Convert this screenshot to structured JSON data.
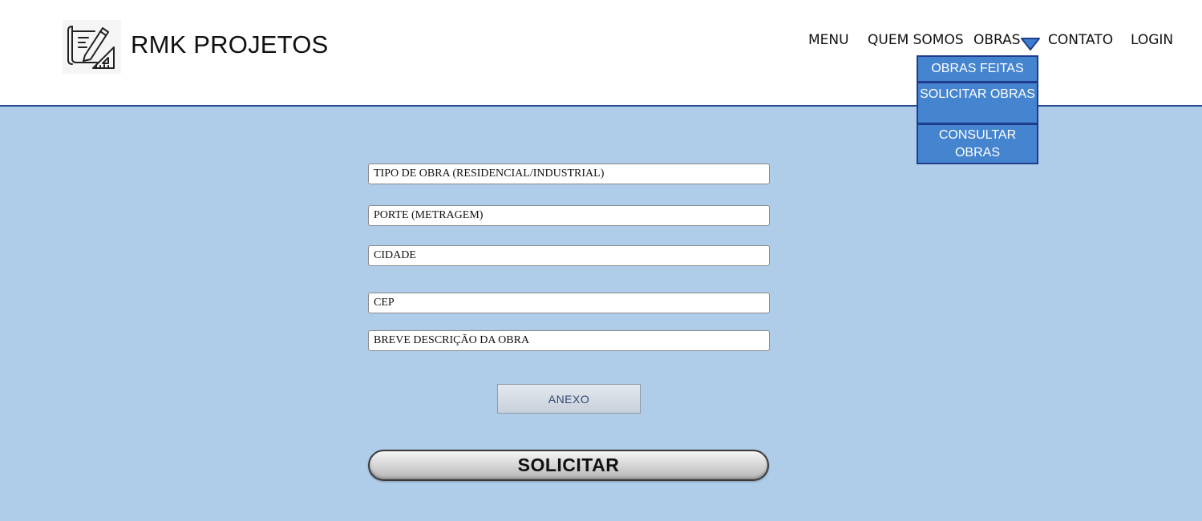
{
  "header": {
    "brand": "RMK PROJETOS",
    "logo_icon": "blueprint-pencil-ruler-icon"
  },
  "nav": {
    "menu": "MENU",
    "about": "QUEM SOMOS",
    "works": "OBRAS",
    "contact": "CONTATO",
    "login": "LOGIN",
    "works_caret_icon": "caret-down-icon"
  },
  "dropdown": {
    "items": [
      "OBRAS FEITAS",
      "SOLICITAR OBRAS",
      "CONSULTAR OBRAS"
    ]
  },
  "form": {
    "fields": [
      {
        "placeholder": "TIPO DE OBRA (RESIDENCIAL/INDUSTRIAL)"
      },
      {
        "placeholder": "PORTE (METRAGEM)"
      },
      {
        "placeholder": "CIDADE"
      },
      {
        "placeholder": "CEP"
      },
      {
        "placeholder": "BREVE DESCRIÇÃO DA OBRA"
      }
    ],
    "attach_label": "ANEXO",
    "submit_label": "SOLICITAR"
  },
  "colors": {
    "background": "#afcde9",
    "header_border": "#2b4a96",
    "dropdown_bg": "#4584cf",
    "dropdown_border": "#1f3c8c",
    "caret": "#3d7ed1"
  }
}
